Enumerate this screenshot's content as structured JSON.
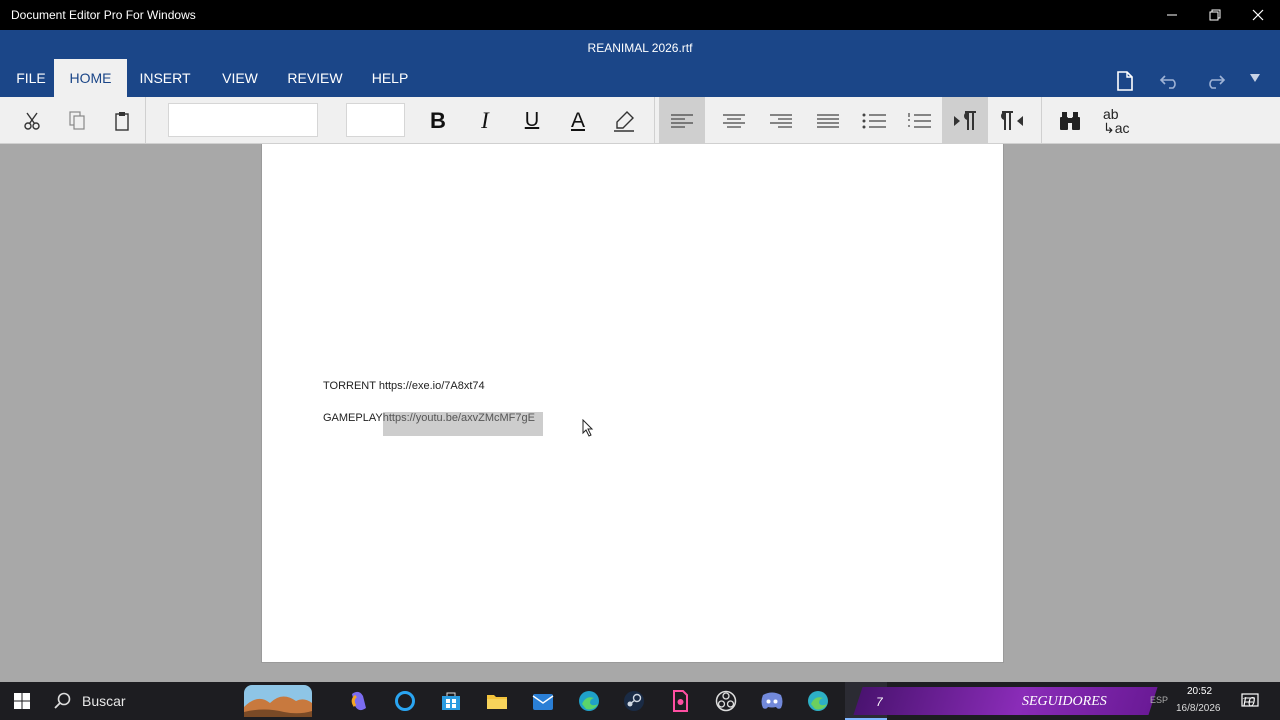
{
  "window": {
    "app_title": "Document Editor Pro For Windows"
  },
  "header": {
    "doc_title": "REANIMAL  2026.rtf"
  },
  "tabs": [
    {
      "label": "FILE"
    },
    {
      "label": "HOME"
    },
    {
      "label": "INSERT"
    },
    {
      "label": "VIEW"
    },
    {
      "label": "REVIEW"
    },
    {
      "label": "HELP"
    }
  ],
  "toolbar": {
    "font_name": "",
    "font_size": "",
    "bold_label": "B",
    "italic_label": "I",
    "underline_label": "U",
    "font_color_label": "A",
    "replace_top": "ab",
    "replace_bottom": "ac"
  },
  "document": {
    "line1_label": "TORRENT",
    "line1_url": "https://exe.io/7A8xt74",
    "line2_label": "GAMEPLAY",
    "line2_url": "https://youtu.be/axvZMcMF7gE"
  },
  "taskbar": {
    "search_label": "Buscar",
    "follower_count": "7",
    "banner_label": "SEGUIDORES",
    "language": "ESP",
    "time": "20:52",
    "date": "16/8/2026",
    "notification_count": "10"
  },
  "colors": {
    "ribbon_blue": "#1b4688",
    "title_bar": "#000000",
    "canvas_gray": "#a8a8a8",
    "selection_gray": "#cdcdcd"
  }
}
